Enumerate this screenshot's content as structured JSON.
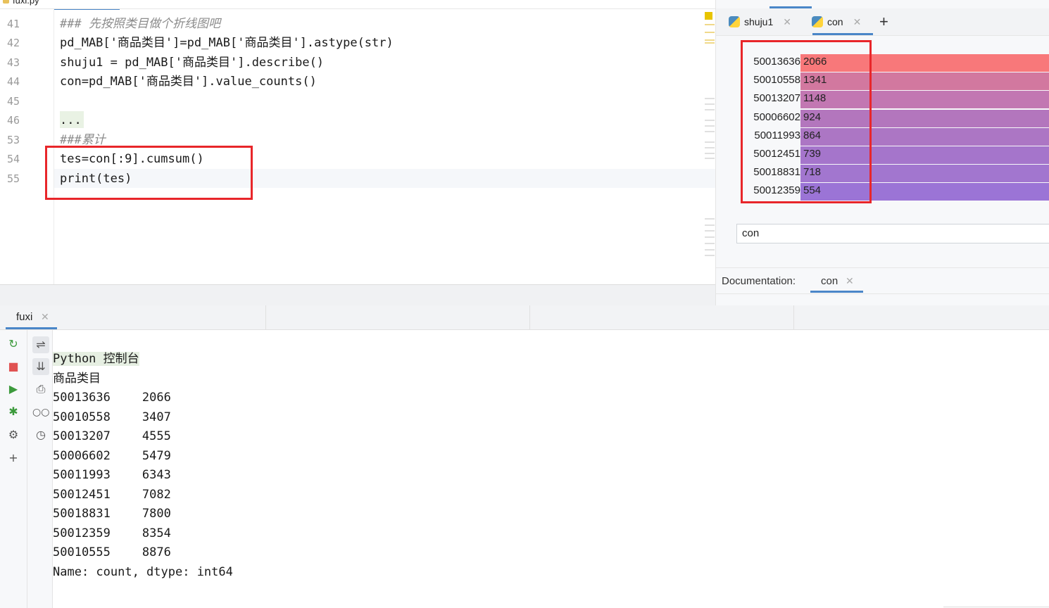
{
  "editor": {
    "file_tab": "fuxi.py",
    "lines": [
      {
        "num": "41",
        "code": "### 先按照类目做个折线图吧"
      },
      {
        "num": "42",
        "code": "pd_MAB['商品类目']=pd_MAB['商品类目'].astype(str)"
      },
      {
        "num": "43",
        "code": "shuju1 = pd_MAB['商品类目'].describe()"
      },
      {
        "num": "44",
        "code": "con=pd_MAB['商品类目'].value_counts()"
      },
      {
        "num": "45",
        "code": ""
      },
      {
        "num": "46",
        "code": "..."
      },
      {
        "num": "53",
        "code": "###累计"
      },
      {
        "num": "54",
        "code": "tes=con[:9].cumsum()"
      },
      {
        "num": "55",
        "code": "print(tes)"
      }
    ]
  },
  "right_panel": {
    "tabs": [
      {
        "label": "shuju1"
      },
      {
        "label": "con"
      }
    ],
    "add_tab": "+",
    "rows": [
      {
        "key": "50013636",
        "value": "2066",
        "color": "#f8787a"
      },
      {
        "key": "50010558",
        "value": "1341",
        "color": "#d2789f"
      },
      {
        "key": "50013207",
        "value": "1148",
        "color": "#c277b2"
      },
      {
        "key": "50006602",
        "value": "924",
        "color": "#b376bd"
      },
      {
        "key": "50011993",
        "value": "864",
        "color": "#ac76c4"
      },
      {
        "key": "50012451",
        "value": "739",
        "color": "#a575cb"
      },
      {
        "key": "50018831",
        "value": "718",
        "color": "#a276cf"
      },
      {
        "key": "50012359",
        "value": "554",
        "color": "#9b74d6"
      }
    ],
    "input_value": "con",
    "documentation_label": "Documentation:",
    "documentation_tab": "con"
  },
  "console": {
    "tab": "fuxi",
    "header": "Python 控制台",
    "index_name": "商品类目",
    "rows": [
      {
        "key": "50013636",
        "value": "2066"
      },
      {
        "key": "50010558",
        "value": "3407"
      },
      {
        "key": "50013207",
        "value": "4555"
      },
      {
        "key": "50006602",
        "value": "5479"
      },
      {
        "key": "50011993",
        "value": "6343"
      },
      {
        "key": "50012451",
        "value": "7082"
      },
      {
        "key": "50018831",
        "value": "7800"
      },
      {
        "key": "50012359",
        "value": "8354"
      },
      {
        "key": "50010555",
        "value": "8876"
      }
    ],
    "footer": "Name: count, dtype: int64"
  },
  "colors": {
    "highlight_box": "#e8262a",
    "accent": "#4a86c8"
  },
  "icons": [
    "rerun-icon",
    "stop-icon",
    "run-icon",
    "debug-icon",
    "settings-icon",
    "add-icon",
    "soft-wrap-icon",
    "scroll-to-end-icon",
    "print-icon",
    "view-icon",
    "history-icon",
    "python-icon",
    "close-icon",
    "plus-icon"
  ]
}
